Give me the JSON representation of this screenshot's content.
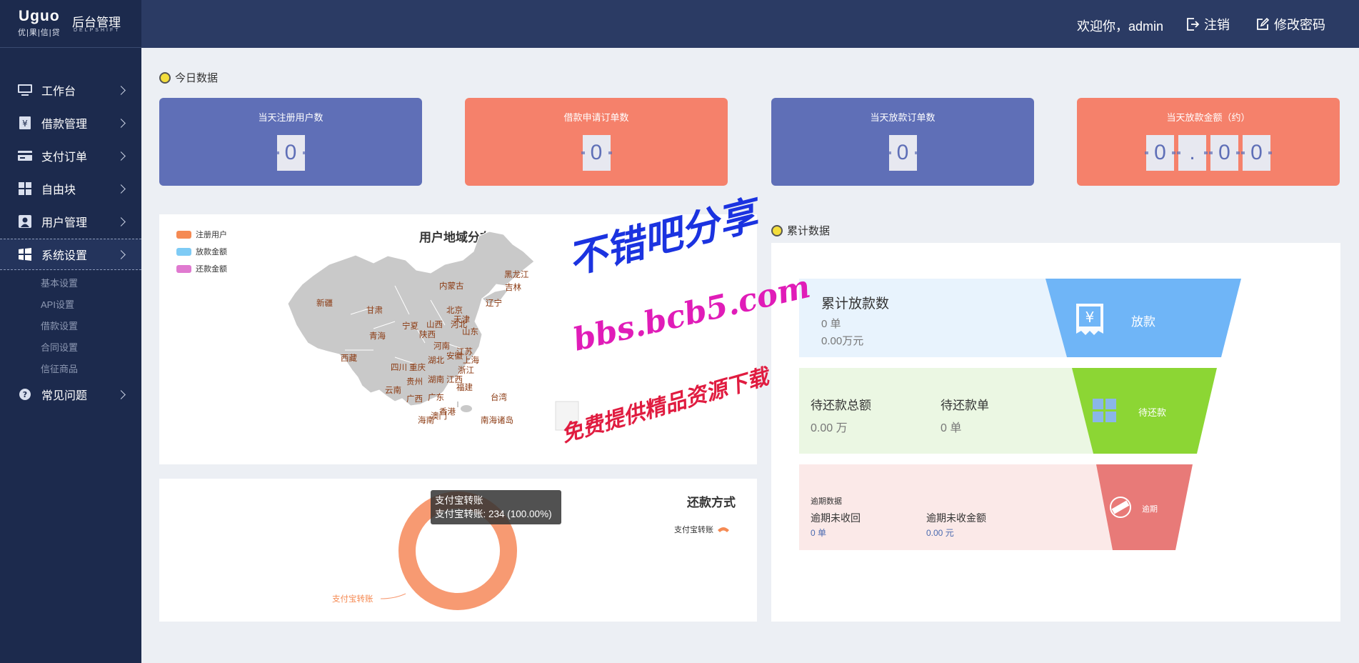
{
  "brand": {
    "logo_text": "Uguo",
    "logo_sub": "优|果|信|贷",
    "app_title": "后台管理",
    "app_sub": "DELPSHIFT"
  },
  "sidebar": {
    "items": [
      {
        "label": "工作台",
        "icon": "monitor-icon"
      },
      {
        "label": "借款管理",
        "icon": "loan-doc-icon"
      },
      {
        "label": "支付订单",
        "icon": "card-icon"
      },
      {
        "label": "自由块",
        "icon": "grid-icon"
      },
      {
        "label": "用户管理",
        "icon": "user-icon"
      },
      {
        "label": "系统设置",
        "icon": "windows-icon",
        "active": true
      },
      {
        "label": "常见问题",
        "icon": "question-icon"
      }
    ],
    "sub_items": [
      "基本设置",
      "API设置",
      "借款设置",
      "合同设置",
      "信征商品"
    ]
  },
  "header": {
    "welcome": "欢迎你，admin",
    "logout": "注销",
    "change_password": "修改密码"
  },
  "today": {
    "title": "今日数据",
    "cards": [
      {
        "title": "当天注册用户数",
        "digits": [
          "0"
        ],
        "color": "#5f6fb7"
      },
      {
        "title": "借款申请订单数",
        "digits": [
          "0"
        ],
        "color": "#f5816b"
      },
      {
        "title": "当天放款订单数",
        "digits": [
          "0"
        ],
        "color": "#5f6fb7"
      },
      {
        "title": "当天放款金额（约）",
        "digits": [
          "0",
          ".",
          "0",
          "0"
        ],
        "color": "#f5816b"
      }
    ]
  },
  "map": {
    "title": "用户地域分布",
    "legend": [
      {
        "label": "注册用户",
        "color": "#f58a53"
      },
      {
        "label": "放款金额",
        "color": "#7ecbf5"
      },
      {
        "label": "还款金额",
        "color": "#e07ad0"
      }
    ],
    "provinces": [
      "黑龙江",
      "吉林",
      "内蒙古",
      "辽宁",
      "新疆",
      "甘肃",
      "北京",
      "天津",
      "宁夏",
      "山西",
      "河北",
      "山东",
      "青海",
      "陕西",
      "河南",
      "江苏",
      "西藏",
      "湖北",
      "安徽",
      "上海",
      "四川",
      "重庆",
      "浙江",
      "贵州",
      "湖南",
      "江西",
      "福建",
      "云南",
      "广西",
      "广东",
      "台湾",
      "香港",
      "澳门",
      "海南",
      "南海诸岛"
    ]
  },
  "repay": {
    "title": "还款方式",
    "legend_label": "支付宝转账",
    "slice_label": "支付宝转账",
    "tooltip_title": "支付宝转账",
    "tooltip_value": "支付宝转账: 234 (100.00%)",
    "color": "#f79a72"
  },
  "chart_data": {
    "type": "pie",
    "title": "还款方式",
    "categories": [
      "支付宝转账"
    ],
    "values": [
      234
    ]
  },
  "cumulative": {
    "title": "累计数据",
    "loan": {
      "title": "累计放款数",
      "count": "0 单",
      "amount": "0.00万元",
      "tag": "放款",
      "color": "#6fb5f7"
    },
    "pending": {
      "total_label": "待还款总额",
      "total_value": "0.00 万",
      "orders_label": "待还款单",
      "orders_value": "0 单",
      "tag": "待还款",
      "color": "#8cd634"
    },
    "overdue": {
      "section_label": "逾期数据",
      "unrecovered_label": "逾期未收回",
      "unrecovered_value": "0 单",
      "amount_label": "逾期未收金额",
      "amount_value": "0.00 元",
      "tag": "逾期",
      "color": "#e87a78"
    }
  },
  "watermark": {
    "line1": "不错吧分享",
    "line2": "bbs.bcb5.com",
    "line3": "免费提供精品资源下载"
  }
}
